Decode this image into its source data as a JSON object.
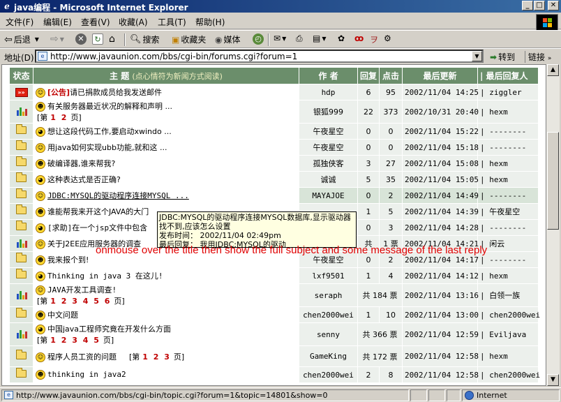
{
  "window": {
    "title": "java编程 - Microsoft Internet Explorer",
    "minimize": "_",
    "maximize": "□",
    "close": "✕"
  },
  "menu": [
    "文件(F)",
    "编辑(E)",
    "查看(V)",
    "收藏(A)",
    "工具(T)",
    "帮助(H)"
  ],
  "toolbar": {
    "back": "后退",
    "search": "搜索",
    "favorites": "收藏夹",
    "media": "媒体"
  },
  "address": {
    "label": "地址(D)",
    "url": "http://www.javaunion.com/bbs/cgi-bin/forums.cgi?forum=1",
    "go": "转到",
    "links": "链接"
  },
  "table": {
    "headers": {
      "status": "状态",
      "subject": "主 题",
      "subject_note": "(点心情符为新闻方式阅读)",
      "author": "作 者",
      "replies": "回复",
      "clicks": "点击",
      "last_update": "最后更新",
      "last_reply": "| 最后回复人"
    },
    "rows": [
      {
        "icon": "hot",
        "subject": "请已捐款成员给我发送邮件",
        "prefix": "[公告]",
        "author": "hdp",
        "replies": "6",
        "clicks": "95",
        "last": "2002/11/04 14:25",
        "lastby": "| ziggler"
      },
      {
        "icon": "bars",
        "subject": "有关服务器最近状况的解释和声明 ...",
        "pages_label": "[第",
        "pages": "1 2",
        "pages_end": "页]",
        "author": "银狐999",
        "replies": "22",
        "clicks": "373",
        "last": "2002/10/31 20:40",
        "lastby": "| hexm"
      },
      {
        "icon": "folder",
        "subject": "想让这段代码工作,要启动xwindo ...",
        "author": "午夜星空",
        "replies": "0",
        "clicks": "0",
        "last": "2002/11/04 15:22",
        "lastby": "| --------"
      },
      {
        "icon": "folder",
        "subject": "用java如何实现ubb功能,就和这  ...",
        "author": "午夜星空",
        "replies": "0",
        "clicks": "0",
        "last": "2002/11/04 15:18",
        "lastby": "| --------"
      },
      {
        "icon": "folder",
        "subject": "破编译器,谁来帮我?",
        "author": "孤独侠客",
        "replies": "3",
        "clicks": "27",
        "last": "2002/11/04 15:08",
        "lastby": "| hexm"
      },
      {
        "icon": "folder",
        "subject": "这种表达式是否正确?",
        "author": "诚诚",
        "replies": "5",
        "clicks": "35",
        "last": "2002/11/04 15:05",
        "lastby": "| hexm"
      },
      {
        "icon": "folder",
        "subject": "JDBC:MYSQL的驱动程序连接MYSQL ...",
        "author": "MAYAJOE",
        "replies": "0",
        "clicks": "2",
        "last": "2002/11/04 14:49",
        "lastby": "| --------"
      },
      {
        "icon": "folder",
        "subject": "谁能帮我来开这个JAVA的大门",
        "author": "",
        "replies": "1",
        "clicks": "5",
        "last": "2002/11/04 14:39",
        "lastby": "| 午夜星空"
      },
      {
        "icon": "folder",
        "subject": "[求助]在一个jsp文件中包含",
        "author": "",
        "replies": "0",
        "clicks": "3",
        "last": "2002/11/04 14:28",
        "lastby": "| --------"
      },
      {
        "icon": "bars",
        "subject": "关于J2EE应用服务器的调查",
        "author": "",
        "replies": "共",
        "clicks": "1 票",
        "last": "2002/11/04 14:21",
        "lastby": "| 闲云"
      },
      {
        "icon": "folder",
        "subject": "我来报个到!",
        "author": "午夜星空",
        "replies": "0",
        "clicks": "2",
        "last": "2002/11/04 14:17",
        "lastby": "| --------"
      },
      {
        "icon": "folder",
        "subject": "Thinking in  java 3 在这儿!",
        "author": "lxf9501",
        "replies": "1",
        "clicks": "4",
        "last": "2002/11/04 14:12",
        "lastby": "| hexm"
      },
      {
        "icon": "bars",
        "subject": "JAVA开发工具调查!",
        "pages_label": "[第",
        "pages": "1 2 3 4 5 6",
        "pages_end": "页]",
        "author": "seraph",
        "replies": "共 184 票",
        "clicks": "",
        "last": "2002/11/04 13:16",
        "lastby": "| 白领一族"
      },
      {
        "icon": "folder",
        "subject": "中文问题",
        "author": "chen2000wei",
        "replies": "1",
        "clicks": "10",
        "last": "2002/11/04 13:00",
        "lastby": "| chen2000wei"
      },
      {
        "icon": "bars",
        "subject": "中国java工程师究竟在开发什么方面",
        "pages_label": "[第",
        "pages": "1 2 3 4 5",
        "pages_end": "页]",
        "author": "senny",
        "replies": "共 366 票",
        "clicks": "",
        "last": "2002/11/04 12:59",
        "lastby": "| Eviljava"
      },
      {
        "icon": "folder",
        "subject": "程序人员工资的问题",
        "pages_label": "[第",
        "pages": "1 2 3",
        "pages_end": "页]",
        "author": "GameKing",
        "replies": "共 172 票",
        "clicks": "",
        "last": "2002/11/04 12:58",
        "lastby": "| hexm"
      },
      {
        "icon": "folder",
        "subject": "thinking in java2",
        "author": "chen2000wei",
        "replies": "2",
        "clicks": "8",
        "last": "2002/11/04 12:58",
        "lastby": "| chen2000wei"
      }
    ]
  },
  "tooltip": {
    "line1": "JDBC:MYSQL的驱动程序连接MYSQL数据库,显示驱动器",
    "line2": "找不到,应该怎么设置",
    "line3": "发布时间：  2002/11/04 02:49pm",
    "line4": "最后回复：  我用JDBC:MYSQL的驱动"
  },
  "annotation": "onmouse over the title  then show the full subject and some message of the last reply",
  "status": {
    "url": "http://www.javaunion.com/bbs/cgi-bin/topic.cgi?forum=1&topic=14801&show=0",
    "zone": "Internet"
  }
}
